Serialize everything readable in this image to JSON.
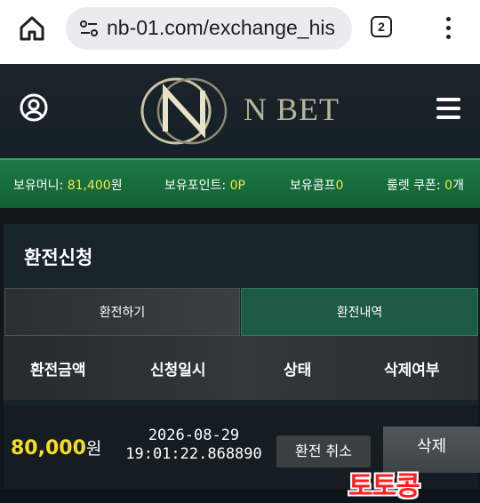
{
  "browser": {
    "url": "nb-01.com/exchange_his",
    "tab_count": "2"
  },
  "site": {
    "logo_text": "N BET"
  },
  "wallet": [
    {
      "label": "보유머니: ",
      "value": "81,400",
      "suffix": "원"
    },
    {
      "label": "보유포인트: ",
      "value": "0P",
      "suffix": ""
    },
    {
      "label": "보유콤프",
      "value": "0",
      "suffix": ""
    },
    {
      "label": "룰렛 쿠폰: ",
      "value": "0",
      "suffix": "개"
    }
  ],
  "panel": {
    "title": "환전신청",
    "tabs": [
      "환전하기",
      "환전내역"
    ],
    "active_tab": "환전내역",
    "columns": [
      "환전금액",
      "신청일시",
      "상태",
      "삭제여부"
    ],
    "rows": [
      {
        "amount": "80,000",
        "amount_unit": "원",
        "date_line1": "2026-08-29",
        "date_line2": "19:01:22.868890",
        "status_button": "환전 취소",
        "delete_button": "삭제"
      }
    ]
  },
  "watermark": "토토콩",
  "colors": {
    "wallet_bar": "#1b7a44",
    "highlight_yellow": "#f5dc2b",
    "active_tab": "#1d5a45",
    "watermark_red": "#ff1f1f"
  }
}
